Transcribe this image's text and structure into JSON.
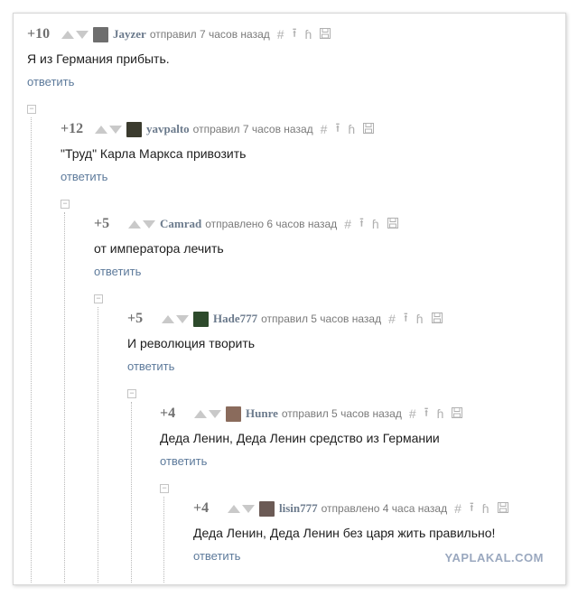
{
  "comments": [
    {
      "score": "+10",
      "user": "Jayzer",
      "posted": "отправил 7 часов назад",
      "text": "Я из Германия прибыть.",
      "reply": "ответить",
      "avatar": "jayzer-avatar",
      "avatar_color": "#6e6e6e"
    },
    {
      "score": "+12",
      "user": "yavpalto",
      "posted": "отправил 7 часов назад",
      "text": "\"Труд\" Карла Маркса привозить",
      "reply": "ответить",
      "avatar": "yavpalto-avatar",
      "avatar_color": "#3b3b2e"
    },
    {
      "score": "+5",
      "user": "Camrad",
      "posted": "отправлено 6 часов назад",
      "text": "от императора лечить",
      "reply": "ответить",
      "avatar": "",
      "avatar_color": ""
    },
    {
      "score": "+5",
      "user": "Hade777",
      "posted": "отправил 5 часов назад",
      "text": "И революция творить",
      "reply": "ответить",
      "avatar": "hade777-avatar",
      "avatar_color": "#2d4a2b"
    },
    {
      "score": "+4",
      "user": "Hunre",
      "posted": "отправил 5 часов назад",
      "text": "Деда Ленин, Деда Ленин средство из Германии",
      "reply": "ответить",
      "avatar": "hunre-avatar",
      "avatar_color": "#8a6b5c"
    },
    {
      "score": "+4",
      "user": "lisin777",
      "posted": "отправлено 4 часа назад",
      "text": "Деда Ленин, Деда Ленин без царя жить правильно!",
      "reply": "ответить",
      "avatar": "lisin777-avatar",
      "avatar_color": "#6b5a55"
    }
  ],
  "collapse_symbol": "⊟",
  "tool_icons": [
    "hash-icon",
    "up-icon",
    "thread-icon",
    "save-icon"
  ],
  "watermark": "YAPLAKAL.COM"
}
